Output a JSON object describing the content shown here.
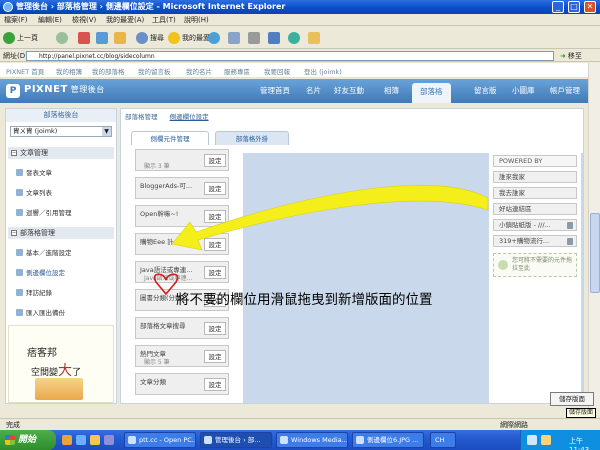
{
  "window": {
    "title": "管理後台 › 部落格管理 › 側邊欄位設定 - Microsoft Internet Explorer",
    "buttons": [
      "_",
      "□",
      "✕"
    ]
  },
  "menu": [
    "檔案(F)",
    "編輯(E)",
    "檢視(V)",
    "我的最愛(A)",
    "工具(T)",
    "說明(H)"
  ],
  "toolbar": {
    "back": "上一頁",
    "search": "搜尋",
    "favorites": "我的最愛"
  },
  "address": {
    "label": "網址(D)",
    "url": "http://panel.pixnet.cc/blog/sidecolumn",
    "go": "移至"
  },
  "pixnet_links": [
    "PIXNET 首頁",
    "我的相簿",
    "我的部落格",
    "我的留言板",
    "我的名片",
    "服務專區",
    "我要回報",
    "登出 (joimk)"
  ],
  "header": {
    "brand": "PIXNET",
    "brand_sub": "管理後台",
    "tabs": [
      "管理首頁",
      "名片",
      "好友互動",
      "相簿",
      "部落格",
      "留言版",
      "小圖庫",
      "帳戶管理"
    ],
    "active_tab": "部落格"
  },
  "sidebar": {
    "title": "部落格後台",
    "account": "胄ㄨ胄 (joimk)",
    "groups": [
      {
        "label": "文章管理",
        "items": [
          "發表文章",
          "文章列表",
          "迴響／引用管理"
        ]
      },
      {
        "label": "部落格管理",
        "items": [
          "基本／進階設定",
          "側邊欄位設定",
          "拜訪紀錄",
          "匯入匯出備份"
        ]
      }
    ],
    "ad": {
      "line1": "痞客邦",
      "line2_prefix": "空間變",
      "line2_big": "大",
      "line2_suffix": "了"
    }
  },
  "main": {
    "breadcrumb_root": "部落格管理",
    "breadcrumb_current": "側邊欄位設定",
    "tabs": [
      "側欄元件管理",
      "部落格外掛"
    ],
    "left_widgets": [
      {
        "name": "",
        "sub": "顯示 3 筆",
        "btn": "設定"
      },
      {
        "name": "BloggerAds-可...",
        "sub": "",
        "btn": "設定"
      },
      {
        "name": "Open幹嘛~!",
        "sub": "",
        "btn": "設定"
      },
      {
        "name": "購物Eee 計...",
        "sub": "",
        "btn": "設定"
      },
      {
        "name": "Java語法或專連...",
        "sub": "Java語法或專連...",
        "btn": "設定"
      },
      {
        "name": "圖書分類(分類)",
        "sub": "",
        "btn": "設定"
      },
      {
        "name": "部落格文章搜尋",
        "sub": "",
        "btn": "設定"
      },
      {
        "name": "熱門文章",
        "sub": "顯示 5 筆",
        "btn": "設定"
      },
      {
        "name": "文章分類",
        "sub": "",
        "btn": "設定"
      }
    ],
    "right_widgets": [
      {
        "name": "POWERED BY",
        "trash": false
      },
      {
        "name": "誰來我家",
        "trash": false
      },
      {
        "name": "我去誰家",
        "trash": false
      },
      {
        "name": "好站連結區",
        "trash": false
      },
      {
        "name": "小鎮貼紙版 - ///...",
        "trash": true
      },
      {
        "name": "319+購物流行...",
        "trash": true
      }
    ],
    "dropzone_text": "您可將不需要的元件拖拉至此",
    "save": "儲存版面",
    "save_tooltip": "儲存版面"
  },
  "annotation": {
    "text": "將不要的欄位用滑鼠拖曳到新增版面的位置",
    "arrow_color": "#f4ef1a"
  },
  "status": {
    "left": "完成",
    "zone": "網際網路"
  },
  "taskbar": {
    "start": "開始",
    "tasks": [
      "ptt.cc - Open PC...",
      "管理後台 › 部...",
      "Windows Media...",
      "側邊欄位6.JPG ...",
      "CH"
    ],
    "active_task": 1,
    "clock": "上午 11:43"
  }
}
